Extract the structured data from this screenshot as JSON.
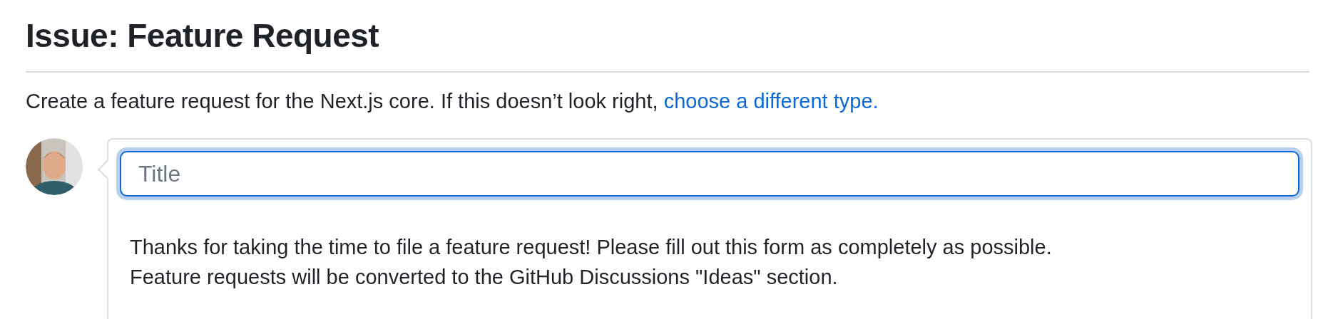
{
  "heading": "Issue: Feature Request",
  "intro": {
    "text": "Create a feature request for the Next.js core. If this doesn’t look right, ",
    "link": "choose a different type."
  },
  "title_field": {
    "placeholder": "Title",
    "focused": true
  },
  "body_lines": [
    "Thanks for taking the time to file a feature request! Please fill out this form as completely as possible.",
    "Feature requests will be converted to the GitHub Discussions \"Ideas\" section."
  ]
}
